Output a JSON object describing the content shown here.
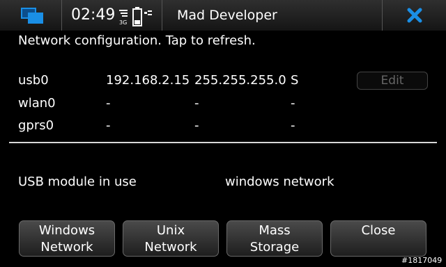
{
  "status_bar": {
    "time": "02:49",
    "network_type": "3G",
    "app_title": "Mad Developer",
    "icons": [
      "task-switcher-icon",
      "signal-icon",
      "battery-icon",
      "usb-icon",
      "close-icon"
    ],
    "accent_color": "#1a8fe6"
  },
  "main": {
    "intro": "Network configuration. Tap to refresh.",
    "interfaces": [
      {
        "name": "usb0",
        "ip": "192.168.2.15",
        "mask": "255.255.255.0",
        "flag": "S",
        "action": "Edit"
      },
      {
        "name": "wlan0",
        "ip": "-",
        "mask": "-",
        "flag": "-"
      },
      {
        "name": "gprs0",
        "ip": "-",
        "mask": "-",
        "flag": "-"
      }
    ],
    "usb_label": "USB module in use",
    "usb_value": "windows network"
  },
  "buttons": [
    {
      "line1": "Windows",
      "line2": "Network"
    },
    {
      "line1": "Unix",
      "line2": "Network"
    },
    {
      "line1": "Mass",
      "line2": "Storage"
    },
    {
      "line1": "Close",
      "line2": ""
    }
  ],
  "watermark": "#1817049"
}
